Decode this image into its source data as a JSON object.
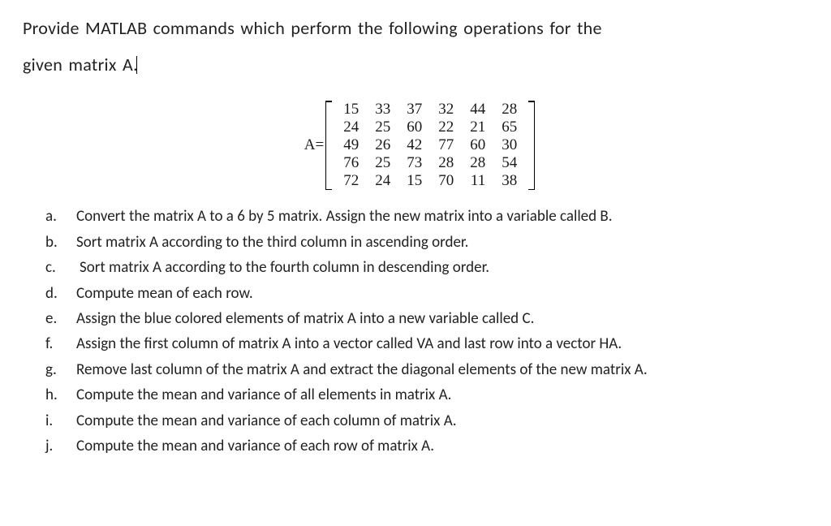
{
  "prompt": {
    "line1": "Provide MATLAB commands which perform the following operations for the",
    "line2": "given matrix A."
  },
  "matrix": {
    "lhs": "A=",
    "rows": [
      [
        15,
        33,
        37,
        32,
        44,
        28
      ],
      [
        24,
        25,
        60,
        22,
        21,
        65
      ],
      [
        49,
        26,
        42,
        77,
        60,
        30
      ],
      [
        76,
        25,
        73,
        28,
        28,
        54
      ],
      [
        72,
        24,
        15,
        70,
        11,
        38
      ]
    ]
  },
  "questions": [
    {
      "label": "a.",
      "text": "Convert the matrix A to a 6 by 5 matrix. Assign the new matrix into a variable called B.",
      "indent": false
    },
    {
      "label": "b.",
      "text": "Sort matrix A according to the third column in ascending order.",
      "indent": false
    },
    {
      "label": "c.",
      "text": "Sort matrix A according to the fourth column in descending order.",
      "indent": true
    },
    {
      "label": "d.",
      "text": "Compute mean of each row.",
      "indent": false
    },
    {
      "label": "e.",
      "text": "Assign the blue colored elements of matrix A into a new variable called C.",
      "indent": false
    },
    {
      "label": "f.",
      "text": "Assign the first column of matrix A into a vector called VA and last row into a vector HA.",
      "indent": false
    },
    {
      "label": "g.",
      "text": "Remove last column of the matrix A and extract the diagonal elements of the new matrix A.",
      "indent": false
    },
    {
      "label": "h.",
      "text": "Compute the mean and variance of all elements in matrix A.",
      "indent": false
    },
    {
      "label": "i.",
      "text": "Compute the mean and variance of each column of matrix A.",
      "indent": false
    },
    {
      "label": "j.",
      "text": "Compute the mean and variance of each row of matrix A.",
      "indent": false
    }
  ]
}
